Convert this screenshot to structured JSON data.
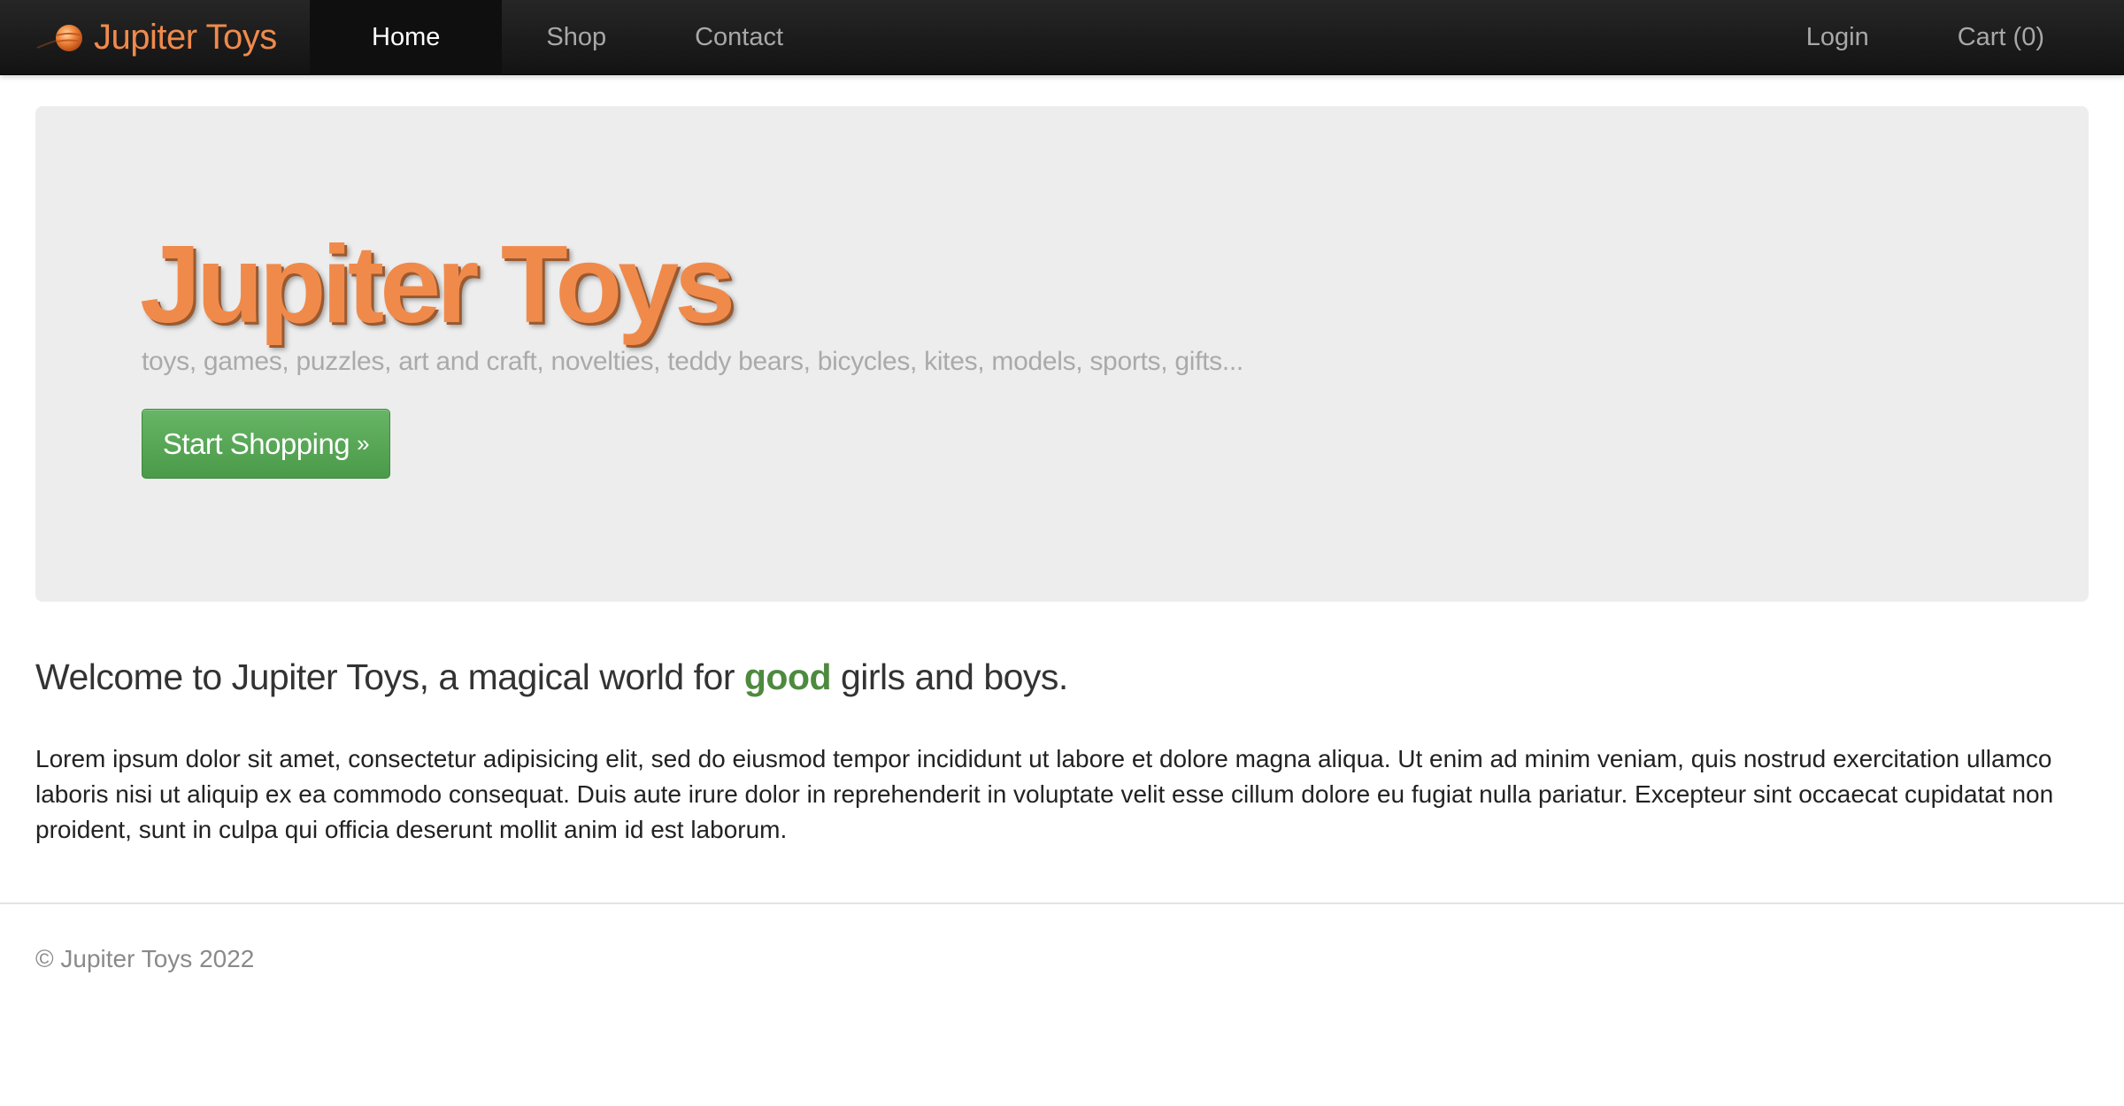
{
  "navbar": {
    "brand": "Jupiter Toys",
    "brand_icon": "planet-logo-icon",
    "left_links": [
      {
        "label": "Home",
        "active": true
      },
      {
        "label": "Shop",
        "active": false
      },
      {
        "label": "Contact",
        "active": false
      }
    ],
    "right_links": [
      {
        "label": "Login"
      },
      {
        "label": "Cart (0)"
      }
    ]
  },
  "hero": {
    "title": "Jupiter Toys",
    "tagline": "toys, games, puzzles, art and craft, novelties, teddy bears, bicycles, kites, models, sports, gifts...",
    "button_label": "Start Shopping",
    "button_suffix": "»"
  },
  "welcome": {
    "before": "Welcome to Jupiter Toys, a magical world for ",
    "emphasis": "good",
    "after": " girls and boys."
  },
  "body_text": "Lorem ipsum dolor sit amet, consectetur adipisicing elit, sed do eiusmod tempor incididunt ut labore et dolore magna aliqua. Ut enim ad minim veniam, quis nostrud exercitation ullamco laboris nisi ut aliquip ex ea commodo consequat. Duis aute irure dolor in reprehenderit in voluptate velit esse cillum dolore eu fugiat nulla pariatur. Excepteur sint occaecat cupidatat non proident, sunt in culpa qui officia deserunt mollit anim id est laborum.",
  "footer": {
    "copyright": "© Jupiter Toys 2022"
  },
  "colors": {
    "brand_orange": "#f08a4b",
    "navbar_bg": "#1c1c1c",
    "hero_bg": "#ededed",
    "button_green": "#5aa859",
    "emphasis_green": "#4e8a3e"
  }
}
